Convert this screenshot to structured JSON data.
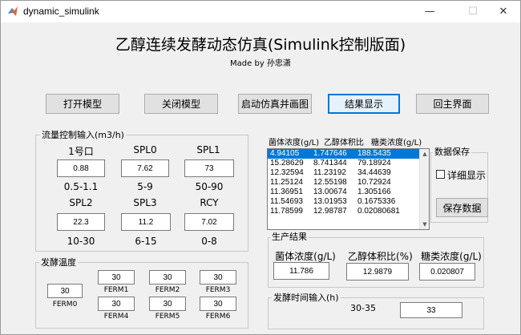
{
  "window": {
    "title": "dynamic_simulink",
    "minimize": "—",
    "maximize": "☐",
    "close": "✕"
  },
  "header": {
    "title": "乙醇连续发酵动态仿真(Simulink控制版面)",
    "byline": "Made by 孙忠潇"
  },
  "toolbar": {
    "open_model": "打开模型",
    "close_model": "关闭模型",
    "start_sim": "启动仿真并画图",
    "show_results": "结果显示",
    "back_main": "回主界面"
  },
  "flow_panel": {
    "title": "流量控制输入(m3/h)",
    "row1": [
      {
        "label": "1号口",
        "value": "0.88",
        "range": "0.5-1.1"
      },
      {
        "label": "SPL0",
        "value": "7.62",
        "range": "5-9"
      },
      {
        "label": "SPL1",
        "value": "73",
        "range": "50-90"
      }
    ],
    "row2": [
      {
        "label": "SPL2",
        "value": "22.3",
        "range": "10-30"
      },
      {
        "label": "SPL3",
        "value": "11.2",
        "range": "6-15"
      },
      {
        "label": "RCY",
        "value": "7.02",
        "range": "0-8"
      }
    ]
  },
  "temp_panel": {
    "title": "发酵温度",
    "ferm0": {
      "label": "FERM0",
      "value": "30"
    },
    "ferms": [
      {
        "label": "FERM1",
        "value": "30"
      },
      {
        "label": "FERM2",
        "value": "30"
      },
      {
        "label": "FERM3",
        "value": "30"
      },
      {
        "label": "FERM4",
        "value": "30"
      },
      {
        "label": "FERM5",
        "value": "30"
      },
      {
        "label": "FERM6",
        "value": "30"
      }
    ]
  },
  "results_list": {
    "headers": [
      "菌体浓度(g/L)",
      "乙醇体积比",
      "糖类浓度(g/L)"
    ],
    "rows": [
      [
        "4.94105",
        "1.747646",
        "188.5435"
      ],
      [
        "15.28629",
        "8.741344",
        "79.18924"
      ],
      [
        "12.32594",
        "11.23192",
        "34.44639"
      ],
      [
        "11.25124",
        "12.55198",
        "10.72924"
      ],
      [
        "11.36951",
        "13.00674",
        "1.305166"
      ],
      [
        "11.54693",
        "13.01953",
        "0.1675336"
      ],
      [
        "11.78599",
        "12.98787",
        "0.02080681"
      ]
    ]
  },
  "data_save": {
    "title": "数据保存",
    "detail_label": "详细显示",
    "save_button": "保存数据"
  },
  "production": {
    "title": "生产结果",
    "items": [
      {
        "label": "菌体浓度(g/L)",
        "value": "11.786"
      },
      {
        "label": "乙醇体积比(%)",
        "value": "12.9879"
      },
      {
        "label": "糖类浓度(g/L)",
        "value": "0.020807"
      }
    ]
  },
  "time_panel": {
    "title": "发酵时间输入(h)",
    "range": "30-35",
    "value": "33"
  }
}
